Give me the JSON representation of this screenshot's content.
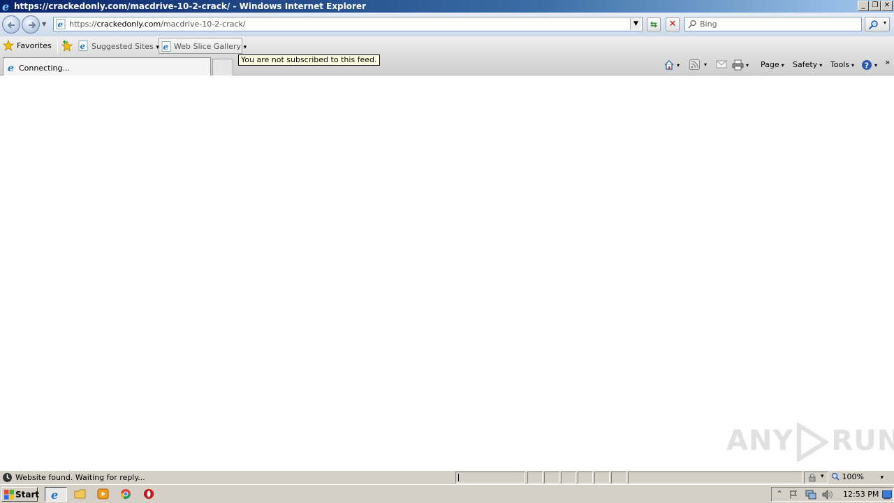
{
  "window": {
    "title": "https://crackedonly.com/macdrive-10-2-crack/ - Windows Internet Explorer",
    "minimize_glyph": "_",
    "maximize_glyph": "❐",
    "close_glyph": "✕"
  },
  "navigation": {
    "address": {
      "scheme": "https://",
      "host": "crackedonly.com",
      "path": "/macdrive-10-2-crack/"
    },
    "search_placeholder": "Bing",
    "dropdown_glyph": "▼"
  },
  "favorites_bar": {
    "favorites_label": "Favorites",
    "links": [
      {
        "label": "Suggested Sites",
        "icon": "ie-page-icon"
      },
      {
        "label": "Web Slice Gallery",
        "icon": "ie-page-icon"
      }
    ],
    "dropdown_glyph": "▾"
  },
  "tabs": {
    "active_label": "Connecting..."
  },
  "tooltip": "You are not subscribed to this feed.",
  "command_bar": {
    "page_label": "Page",
    "safety_label": "Safety",
    "tools_label": "Tools",
    "dropdown_glyph": "▾",
    "overflow_glyph": "»"
  },
  "watermark": {
    "left": "ANY",
    "right": "RUN"
  },
  "status_bar": {
    "text": "Website found. Waiting for reply...",
    "zoom": "100%"
  },
  "taskbar": {
    "start_label": "Start",
    "clock": "12:53 PM"
  }
}
